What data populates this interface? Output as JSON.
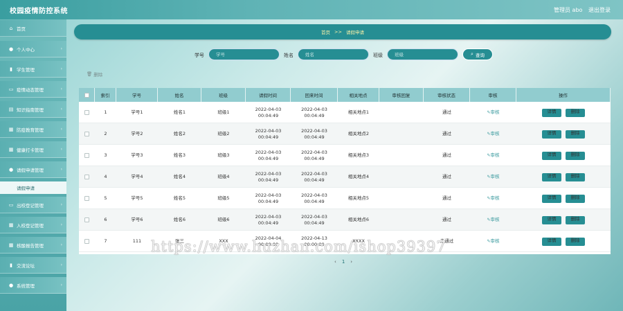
{
  "app": {
    "title": "校园疫情防控系统",
    "admin_label": "管理员 abo",
    "logout_label": "退出登录"
  },
  "sidebar": {
    "items": [
      {
        "label": "首页",
        "icon": "home-icon",
        "glyph": "⌂"
      },
      {
        "label": "个人中心",
        "icon": "user-icon",
        "glyph": "●"
      },
      {
        "label": "学生管理",
        "icon": "chart-icon",
        "glyph": "▮"
      },
      {
        "label": "疫情动态管理",
        "icon": "monitor-icon",
        "glyph": "▭"
      },
      {
        "label": "知识指南管理",
        "icon": "doc-icon",
        "glyph": "▤"
      },
      {
        "label": "防疫教育管理",
        "icon": "calendar-icon",
        "glyph": "▦"
      },
      {
        "label": "健康打卡管理",
        "icon": "grid-icon",
        "glyph": "▦"
      },
      {
        "label": "请假申请管理",
        "icon": "user-icon",
        "glyph": "●"
      },
      {
        "label": "出校登记管理",
        "icon": "monitor-icon",
        "glyph": "▭"
      },
      {
        "label": "入校登记管理",
        "icon": "grid-icon",
        "glyph": "▦"
      },
      {
        "label": "核酸报告管理",
        "icon": "grid-icon",
        "glyph": "▦"
      },
      {
        "label": "交流论坛",
        "icon": "chart-icon",
        "glyph": "▮"
      },
      {
        "label": "系统管理",
        "icon": "bulb-icon",
        "glyph": "●"
      }
    ],
    "active_sub": "请假申请"
  },
  "breadcrumb": {
    "home": "首页",
    "sep": ">>",
    "current": "请假申请"
  },
  "filters": {
    "student_no_label": "学号",
    "student_no_placeholder": "学号",
    "name_label": "姓名",
    "name_placeholder": "姓名",
    "class_label": "班级",
    "class_placeholder": "班级",
    "query_label": "查询",
    "delete_label": "删除"
  },
  "table": {
    "headers": [
      "索引",
      "学号",
      "姓名",
      "班级",
      "请假时间",
      "回来时间",
      "相关地点",
      "审核回复",
      "审核状态",
      "审核",
      "操作"
    ],
    "rows": [
      {
        "idx": "1",
        "no": "学号1",
        "name": "姓名1",
        "cls": "班级1",
        "leave": "2022-04-03 00:04:49",
        "back": "2022-04-03 00:04:49",
        "place": "相关地点1",
        "reply": "",
        "status": "通过",
        "audit": "审核"
      },
      {
        "idx": "2",
        "no": "学号2",
        "name": "姓名2",
        "cls": "班级2",
        "leave": "2022-04-03 00:04:49",
        "back": "2022-04-03 00:04:49",
        "place": "相关地点2",
        "reply": "",
        "status": "通过",
        "audit": "审核"
      },
      {
        "idx": "3",
        "no": "学号3",
        "name": "姓名3",
        "cls": "班级3",
        "leave": "2022-04-03 00:04:49",
        "back": "2022-04-03 00:04:49",
        "place": "相关地点3",
        "reply": "",
        "status": "通过",
        "audit": "审核"
      },
      {
        "idx": "4",
        "no": "学号4",
        "name": "姓名4",
        "cls": "班级4",
        "leave": "2022-04-03 00:04:49",
        "back": "2022-04-03 00:04:49",
        "place": "相关地点4",
        "reply": "",
        "status": "通过",
        "audit": "审核"
      },
      {
        "idx": "5",
        "no": "学号5",
        "name": "姓名5",
        "cls": "班级5",
        "leave": "2022-04-03 00:04:49",
        "back": "2022-04-03 00:04:49",
        "place": "相关地点5",
        "reply": "",
        "status": "通过",
        "audit": "审核"
      },
      {
        "idx": "6",
        "no": "学号6",
        "name": "姓名6",
        "cls": "班级6",
        "leave": "2022-04-03 00:04:49",
        "back": "2022-04-03 00:04:49",
        "place": "相关地点6",
        "reply": "",
        "status": "通过",
        "audit": "审核"
      },
      {
        "idx": "7",
        "no": "111",
        "name": "张三",
        "cls": "XXX",
        "leave": "2022-04-04 00:00:00",
        "back": "2022-04-13 00:00:00",
        "place": "XXXX",
        "reply": "",
        "status": "未通过",
        "audit": "审核"
      }
    ],
    "detail_label": "详情",
    "delete_label": "删除"
  },
  "pager": {
    "prev": "‹",
    "current": "1",
    "next": "›"
  },
  "watermark": "https://www.huzhan.com/ishop39397",
  "colors": {
    "primary": "#268e93",
    "header": "#91cccf",
    "crumb_text": "#f7f0a8"
  }
}
